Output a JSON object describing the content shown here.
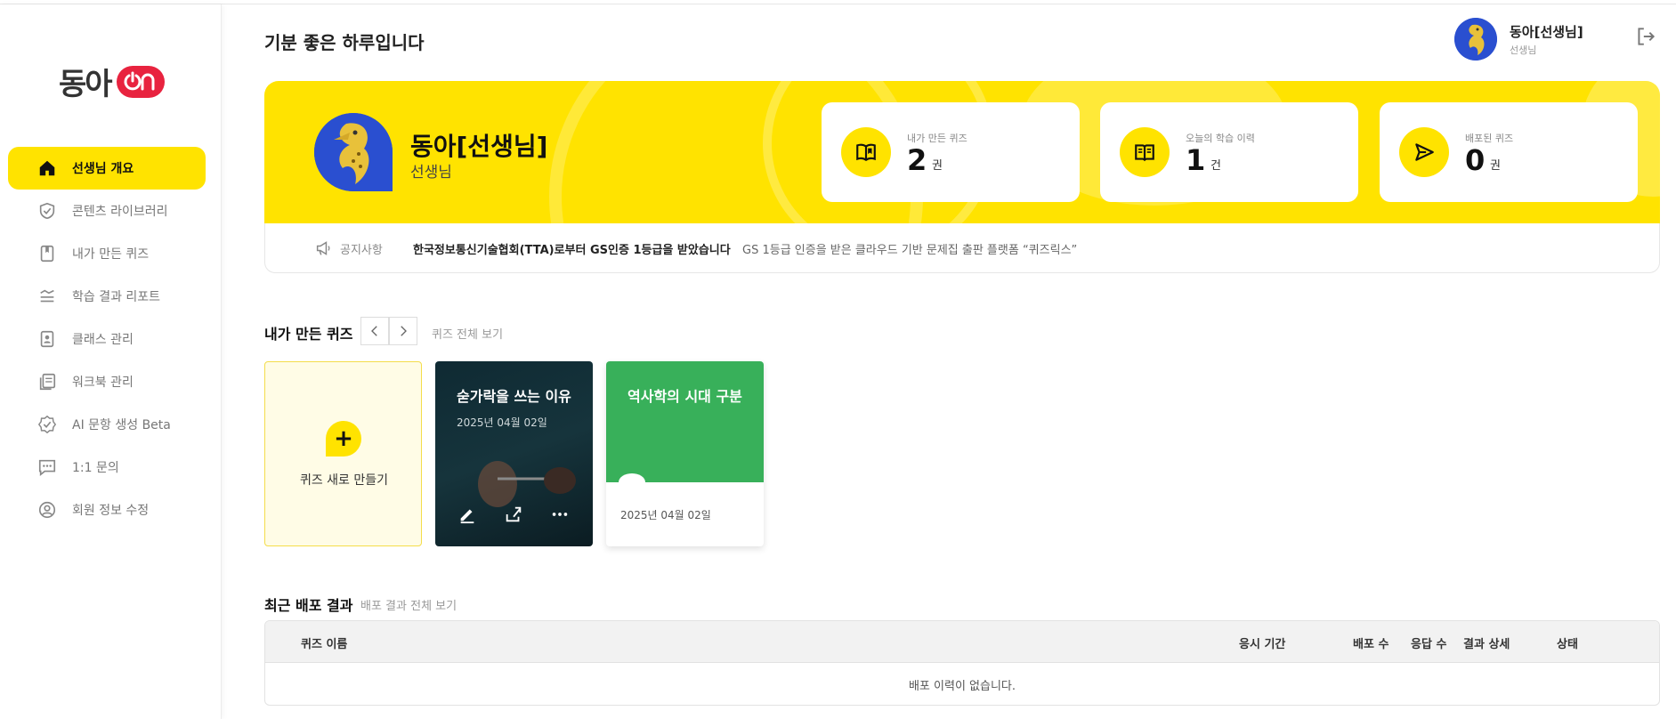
{
  "brand": {
    "logo_text": "동아",
    "logo_badge": "On",
    "accent": "#ffe300",
    "badge_color": "#e8233f"
  },
  "sidebar": {
    "items": [
      {
        "label": "선생님 개요",
        "icon": "home-icon",
        "active": true
      },
      {
        "label": "콘텐츠 라이브러리",
        "icon": "shield-check-icon"
      },
      {
        "label": "내가 만든 퀴즈",
        "icon": "bookmark-icon"
      },
      {
        "label": "학습 결과 리포트",
        "icon": "report-lines-icon"
      },
      {
        "label": "클래스 관리",
        "icon": "user-file-icon"
      },
      {
        "label": "워크북 관리",
        "icon": "workbook-icon"
      },
      {
        "label": "AI 문항 생성 Beta",
        "icon": "badge-check-icon"
      },
      {
        "label": "1:1 문의",
        "icon": "chat-icon"
      },
      {
        "label": "회원 정보 수정",
        "icon": "user-circle-icon"
      }
    ]
  },
  "header": {
    "greeting": "기분 좋은 하루입니다",
    "user_name": "동아[선생님]",
    "user_role": "선생님"
  },
  "banner": {
    "name": "동아[선생님]",
    "role": "선생님",
    "stats": [
      {
        "label": "내가 만든 퀴즈",
        "value": "2",
        "unit": "권",
        "icon": "open-book-icon"
      },
      {
        "label": "오늘의 학습 이력",
        "value": "1",
        "unit": "건",
        "icon": "book-icon"
      },
      {
        "label": "배포된 퀴즈",
        "value": "0",
        "unit": "권",
        "icon": "send-icon"
      }
    ]
  },
  "notice": {
    "tag": "공지사항",
    "title": "한국정보통신기술협회(TTA)로부터 GS인증 1등급을 받았습니다",
    "desc": "GS 1등급 인증을 받은 클라우드 기반 문제집 출판 플랫폼 “퀴즈릭스”"
  },
  "quiz_section": {
    "title": "내가 만든 퀴즈",
    "view_all": "퀴즈 전체 보기",
    "new_label": "퀴즈 새로 만들기",
    "cards": [
      {
        "title": "숟가락을 쓰는 이유",
        "date": "2025년 04월 02일"
      },
      {
        "title": "역사학의 시대 구분",
        "date": "2025년 04월 02일",
        "color": "#38b05a"
      }
    ]
  },
  "deploy_section": {
    "title": "최근 배포 결과",
    "view_all": "배포 결과 전체 보기",
    "columns": [
      "퀴즈 이름",
      "응시 기간",
      "배포 수",
      "응답 수",
      "결과 상세",
      "상태"
    ],
    "empty": "배포 이력이 없습니다."
  }
}
